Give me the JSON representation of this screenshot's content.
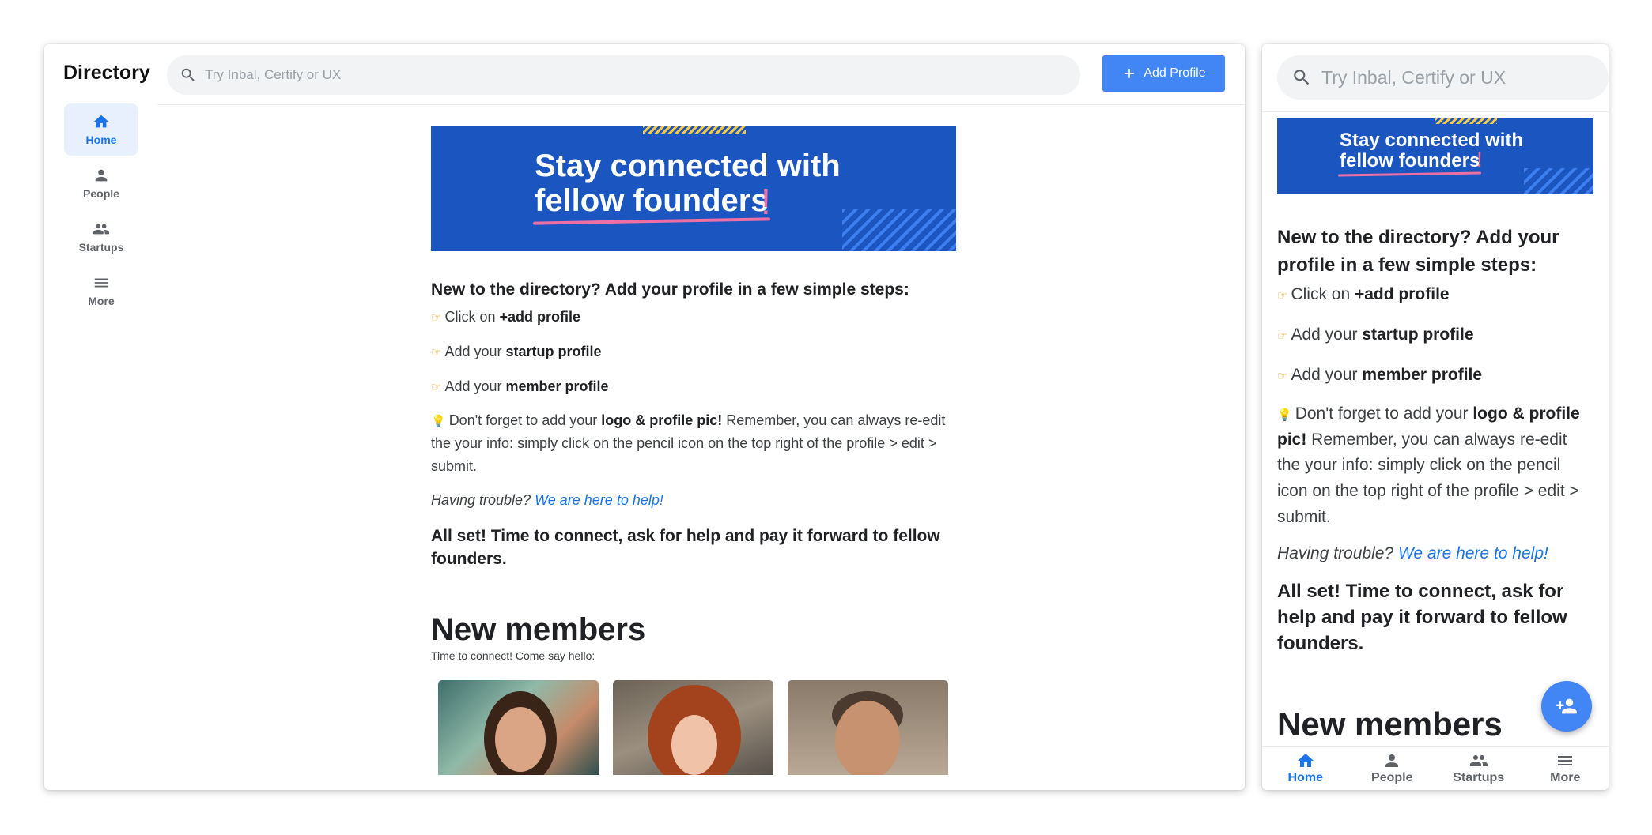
{
  "app": {
    "title": "Directory"
  },
  "nav": [
    {
      "label": "Home",
      "icon": "home-icon",
      "active": true
    },
    {
      "label": "People",
      "icon": "person-icon",
      "active": false
    },
    {
      "label": "Startups",
      "icon": "group-icon",
      "active": false
    },
    {
      "label": "More",
      "icon": "menu-icon",
      "active": false
    }
  ],
  "search": {
    "placeholder": "Try Inbal, Certify or UX",
    "value": ""
  },
  "toolbar": {
    "add_profile_label": "Add Profile"
  },
  "banner": {
    "line1": "Stay connected with",
    "line2": "fellow founders",
    "mark": "!"
  },
  "intro": {
    "title": "New to the directory? Add your profile in a few simple steps:",
    "steps": [
      {
        "prefix": "Click on ",
        "bold": "+add profile"
      },
      {
        "prefix": "Add your ",
        "bold": "startup profile"
      },
      {
        "prefix": "Add your ",
        "bold": "member profile"
      }
    ],
    "tip": {
      "prefix": "Don't forget to add your ",
      "bold": "logo & profile pic!",
      "suffix": " Remember, you can always re-edit the your info: simply click on the pencil icon on the top right of the profile > edit > submit."
    },
    "trouble": {
      "text": "Having trouble? ",
      "link": "We are here to help!"
    },
    "all_set": "All set! Time to connect, ask for help and pay it forward to fellow founders."
  },
  "new_members": {
    "title": "New members",
    "subtitle": "Time to connect! Come say hello:"
  },
  "colors": {
    "accent": "#4285f4",
    "banner_bg": "#1a55c0",
    "link": "#1a73e8",
    "nav_active_bg": "#e8f0fe"
  }
}
